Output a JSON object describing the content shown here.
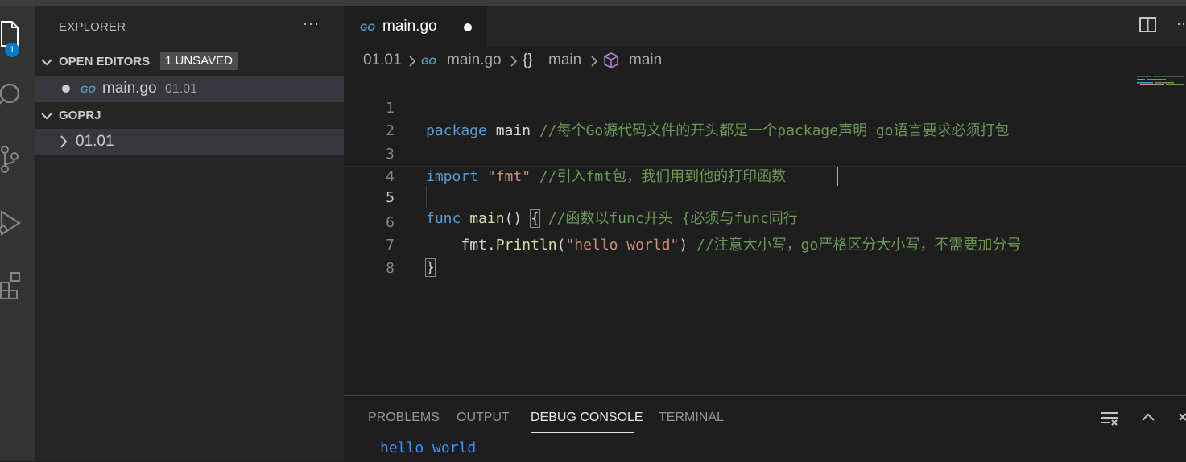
{
  "activity_bar": {
    "explorer_badge": "1"
  },
  "sidebar": {
    "title": "EXPLORER",
    "more": "···",
    "open_editors": {
      "label": "OPEN EDITORS",
      "badge": "1 UNSAVED",
      "items": [
        {
          "icon": "GO",
          "name": "main.go",
          "dir": "01.01"
        }
      ]
    },
    "workspace": {
      "label": "GOPRJ",
      "folders": [
        "01.01"
      ]
    }
  },
  "editor": {
    "tab": {
      "icon": "GO",
      "name": "main.go"
    },
    "more": "···",
    "breadcrumb": {
      "folder": "01.01",
      "file_icon": "GO",
      "file": "main.go",
      "scope_icon": "{}",
      "scope": "main",
      "symbol": "main"
    },
    "lines": [
      {
        "n": "1",
        "kw": "package",
        "rest": " main ",
        "comment": "//每个Go源代码文件的开头都是一个package声明 go语言要求必须打包"
      },
      {
        "n": "2"
      },
      {
        "n": "3",
        "kw": "import",
        "sp": " ",
        "str": "\"fmt\"",
        "comment": " //引入fmt包，我们用到他的打印函数"
      },
      {
        "n": "4"
      },
      {
        "n": "5",
        "kw": "func",
        "sp": " ",
        "fn": "main",
        "paren": "() ",
        "brace": "{",
        "comment": " //函数以func开头 {必须与func同行"
      },
      {
        "n": "6",
        "indent": "    ",
        "obj": "fmt.",
        "fn": "Println",
        "open": "(",
        "str": "\"hello world\"",
        "close": ") ",
        "comment": "//注意大小写，go严格区分大小写，不需要加分号"
      },
      {
        "n": "7",
        "brace": "}"
      },
      {
        "n": "8"
      }
    ]
  },
  "panel": {
    "tabs": [
      "PROBLEMS",
      "OUTPUT",
      "DEBUG CONSOLE",
      "TERMINAL"
    ],
    "active_tab": "DEBUG CONSOLE",
    "output": "hello world"
  },
  "colors": {
    "accent": "#007acc",
    "keyword": "#569cd6",
    "function": "#dcdcaa",
    "string": "#ce9178",
    "comment": "#6a9955",
    "console_text": "#3794ff"
  }
}
